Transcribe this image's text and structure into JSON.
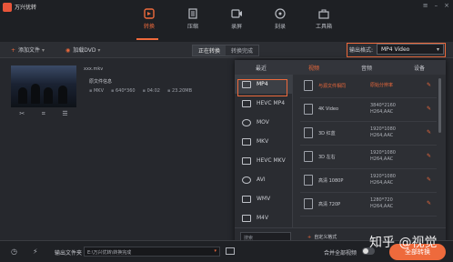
{
  "app": {
    "title": "万兴优转"
  },
  "nav": {
    "tabs": [
      {
        "label": "转换",
        "active": true
      },
      {
        "label": "压缩",
        "active": false
      },
      {
        "label": "录屏",
        "active": false
      },
      {
        "label": "刻录",
        "active": false
      },
      {
        "label": "工具箱",
        "active": false
      }
    ]
  },
  "toolbar": {
    "add_file": "添加文件",
    "load_dvd": "加载DVD",
    "segments": [
      "正在转换",
      "转换完成"
    ],
    "output_format_label": "输出格式:",
    "output_format_value": "MP4 Video"
  },
  "file": {
    "name": "xxx.mkv",
    "source_label": "原文件信息",
    "meta": [
      "MKV",
      "640*360",
      "04:02",
      "23.20MB"
    ]
  },
  "panel": {
    "tabs": [
      "最近",
      "视频",
      "音频",
      "设备"
    ],
    "active_tab": 1,
    "formats": [
      "MP4",
      "HEVC MP4",
      "MOV",
      "MKV",
      "HEVC MKV",
      "AVI",
      "WMV",
      "M4V"
    ],
    "selected_format": 0,
    "presets": [
      {
        "name": "与源文件相同",
        "res": "原始分辨率",
        "codec": ""
      },
      {
        "name": "4K Video",
        "res": "3840*2160",
        "codec": "H264,AAC"
      },
      {
        "name": "3D 红蓝",
        "res": "1920*1080",
        "codec": "H264,AAC"
      },
      {
        "name": "3D 左右",
        "res": "1920*1080",
        "codec": "H264,AAC"
      },
      {
        "name": "高清 1080P",
        "res": "1920*1080",
        "codec": "H264,AAC"
      },
      {
        "name": "高清 720P",
        "res": "1280*720",
        "codec": "H264,AAC"
      }
    ],
    "search_placeholder": "搜索",
    "custom_label": "自定义格式"
  },
  "bottom": {
    "output_folder_label": "输出文件夹",
    "output_path": "E:\\万兴优转\\转换完成",
    "merge_label": "合并全部视频",
    "merge_enabled": false,
    "convert_all": "全部转换"
  },
  "watermark": "知乎 @视觉",
  "colors": {
    "accent": "#ee6a3c",
    "background": "#25272c"
  }
}
